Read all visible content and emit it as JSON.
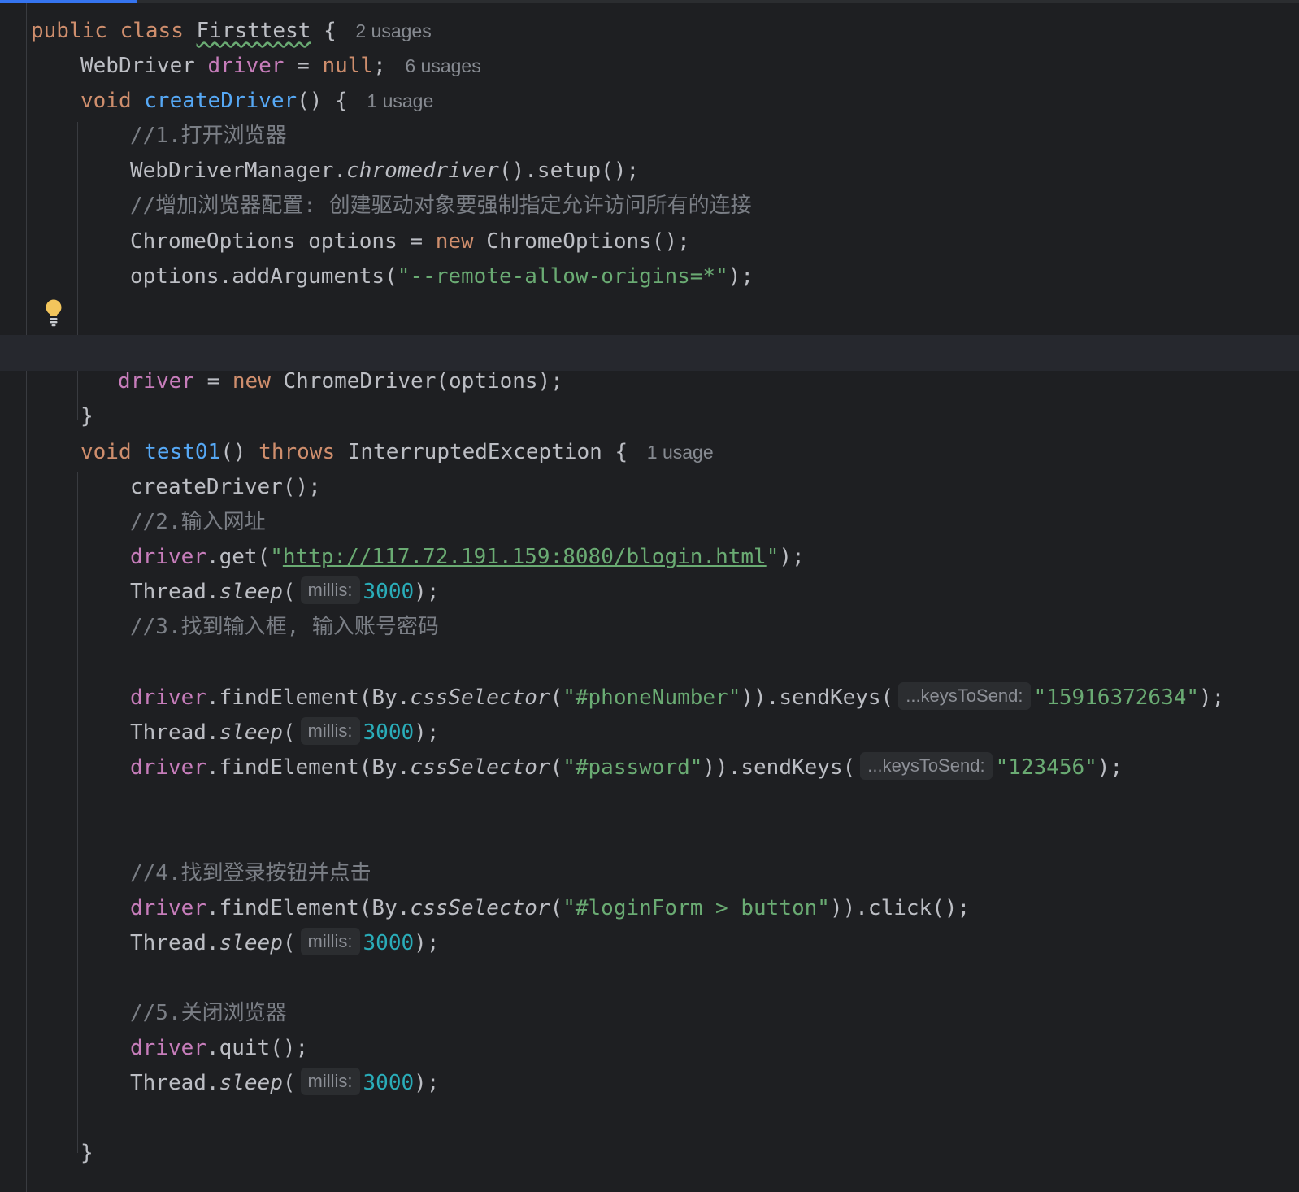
{
  "editor": {
    "class_decl": {
      "kw_public": "public",
      "kw_class": "class",
      "name": "Firsttest",
      "brace": "{",
      "hint": "2 usages"
    },
    "field": {
      "type": "WebDriver",
      "name": "driver",
      "eq": "=",
      "value": "null",
      "semi": ";",
      "hint": "6 usages"
    },
    "create_driver": {
      "kw_void": "void",
      "name": "createDriver",
      "rest": "() {",
      "hint": "1 usage"
    },
    "comment1": "//1.打开浏览器",
    "setup": {
      "cls": "WebDriverManager.",
      "method": "chromedriver",
      "rest": "().setup();"
    },
    "comment_config": "//增加浏览器配置: 创建驱动对象要强制指定允许访问所有的连接",
    "options_decl": {
      "lhs": "ChromeOptions options = ",
      "kw_new": "new",
      "rhs": " ChromeOptions();"
    },
    "options_add": {
      "prefix": "options.addArguments(",
      "arg": "\"--remote-allow-origins=*\"",
      "suffix": ");"
    },
    "assign_driver": {
      "var": "driver",
      "mid": " = ",
      "kw_new": "new",
      "rest": " ChromeDriver(options);"
    },
    "close_brace_1": "}",
    "test01": {
      "kw_void": "void",
      "name": "test01",
      "paren": "()",
      "kw_throws": "throws",
      "rest": "InterruptedException {",
      "hint": "1 usage"
    },
    "create_call": "createDriver();",
    "comment2": "//2.输入网址",
    "get": {
      "var": "driver",
      "mid": ".get(",
      "q_open": "\"",
      "url": "http://117.72.191.159:8080/blogin.html",
      "q_close": "\"",
      "suffix": ");"
    },
    "sleep": {
      "cls": "Thread.",
      "method": "sleep",
      "open": "(",
      "param": "millis:",
      "value": "3000",
      "close": ");"
    },
    "comment3": "//3.找到输入框, 输入账号密码",
    "phone": {
      "var": "driver",
      "mid": ".findElement(By.",
      "method": "cssSelector",
      "open": "(",
      "selector": "\"#phoneNumber\"",
      "send": ")).sendKeys(",
      "param": "...keysToSend:",
      "value": "\"15916372634\"",
      "close": ");"
    },
    "password": {
      "var": "driver",
      "mid": ".findElement(By.",
      "method": "cssSelector",
      "open": "(",
      "selector": "\"#password\"",
      "send": ")).sendKeys(",
      "param": "...keysToSend:",
      "value": "\"123456\"",
      "close": ");"
    },
    "comment4": "//4.找到登录按钮并点击",
    "login": {
      "var": "driver",
      "mid": ".findElement(By.",
      "method": "cssSelector",
      "open": "(",
      "selector": "\"#loginForm > button\"",
      "close": ")).click();"
    },
    "comment5": "//5.关闭浏览器",
    "quit": {
      "var": "driver",
      "rest": ".quit();"
    },
    "close_brace_2": "}"
  },
  "icons": {
    "intention": "lightbulb-icon"
  },
  "colors": {
    "background": "#1e1f22",
    "keyword": "#cf8e6d",
    "field": "#c77dbb",
    "function": "#56a8f5",
    "string": "#6aab73",
    "number": "#2aacb8",
    "comment": "#7a7e85",
    "text": "#bcbec4",
    "hint": "#868a91",
    "bulb": "#f2c55c"
  }
}
